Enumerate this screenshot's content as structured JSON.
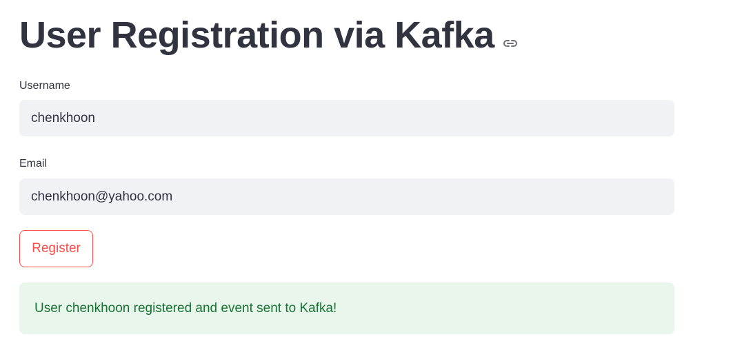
{
  "page": {
    "title": "User Registration via Kafka"
  },
  "form": {
    "username": {
      "label": "Username",
      "value": "chenkhoon"
    },
    "email": {
      "label": "Email",
      "value": "chenkhoon@yahoo.com"
    },
    "register_button_label": "Register"
  },
  "alert": {
    "type": "success",
    "message": "User chenkhoon registered and event sent to Kafka!"
  },
  "icons": {
    "title_anchor": "link-icon"
  },
  "colors": {
    "text": "#31333f",
    "accent": "#ff4b4b",
    "input_bg": "#f0f2f6",
    "success_bg": "#e8f6ec",
    "success_text": "#177233"
  }
}
